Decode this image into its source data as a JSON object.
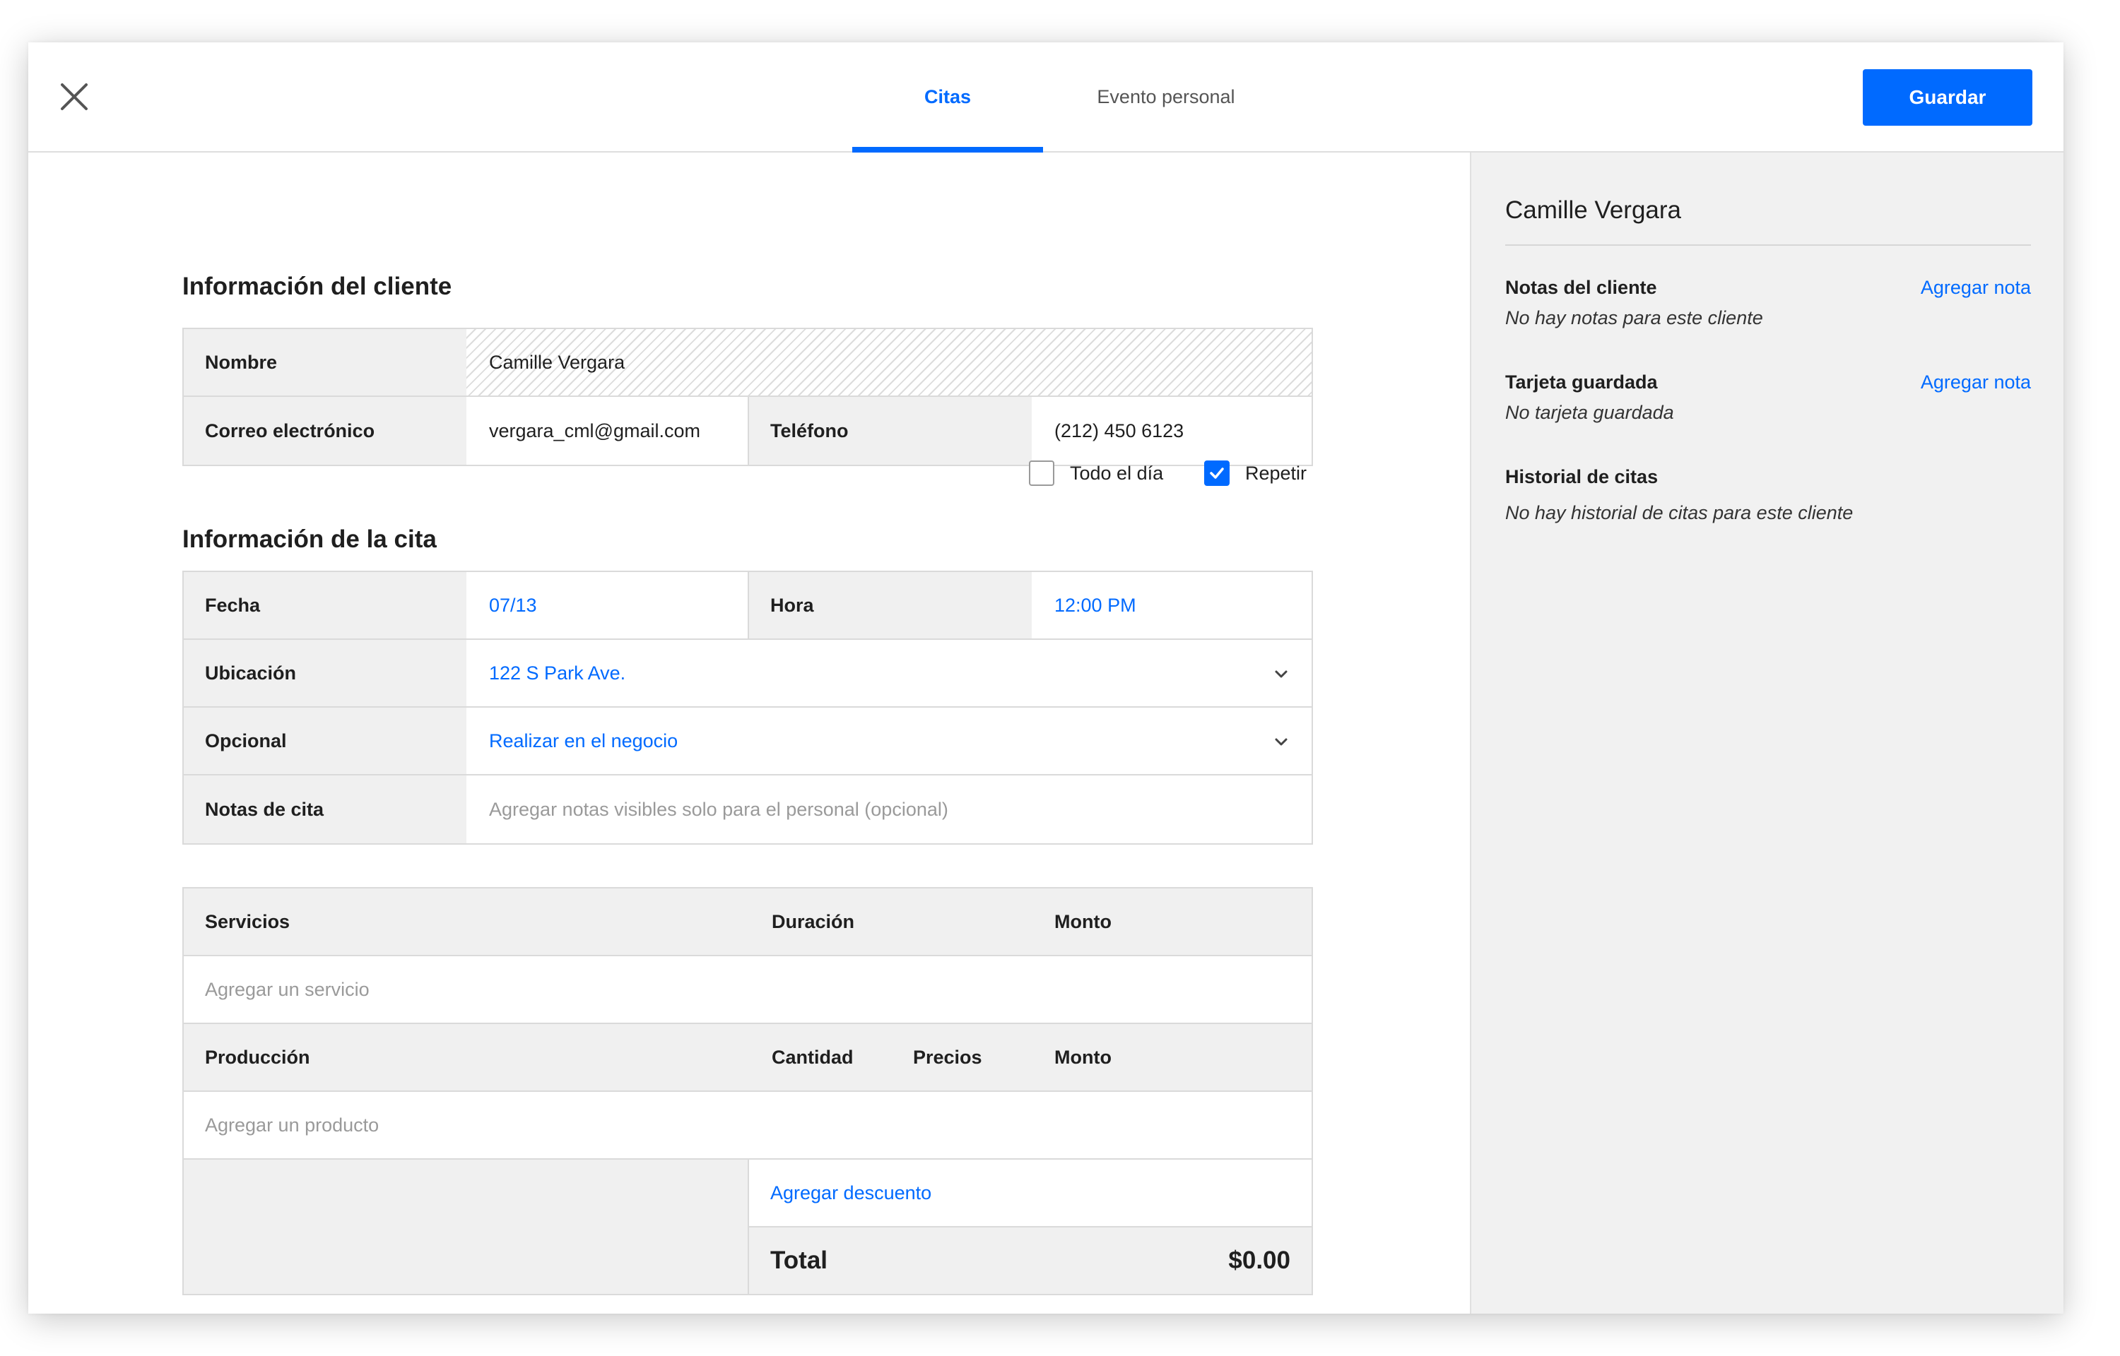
{
  "header": {
    "tabs": [
      {
        "label": "Citas",
        "active": true
      },
      {
        "label": "Evento personal",
        "active": false
      }
    ],
    "save_label": "Guardar",
    "close_icon": "close-icon"
  },
  "client_info": {
    "title": "Información del cliente",
    "name_label": "Nombre",
    "name_value": "Camille Vergara",
    "email_label": "Correo electrónico",
    "email_value": "vergara_cml@gmail.com",
    "phone_label": "Teléfono",
    "phone_value": "(212) 450 6123"
  },
  "appointment": {
    "title": "Información de la cita",
    "all_day_label": "Todo el día",
    "all_day_checked": false,
    "repeat_label": "Repetir",
    "repeat_checked": true,
    "date_label": "Fecha",
    "date_value": "07/13",
    "time_label": "Hora",
    "time_value": "12:00 PM",
    "location_label": "Ubicación",
    "location_value": "122 S Park Ave.",
    "optional_label": "Opcional",
    "optional_value": "Realizar en el negocio",
    "notes_label": "Notas de cita",
    "notes_placeholder": "Agregar notas visibles solo para el personal (opcional)"
  },
  "services": {
    "headers": [
      "Servicios",
      "Duración",
      "Monto"
    ],
    "add_placeholder": "Agregar un servicio"
  },
  "production": {
    "headers": [
      "Producción",
      "Cantidad",
      "Precios",
      "Monto"
    ],
    "add_placeholder": "Agregar un producto",
    "discount_label": "Agregar descuento",
    "total_label": "Total",
    "total_value": "$0.00"
  },
  "side_panel": {
    "client_name": "Camille Vergara",
    "notes_title": "Notas del cliente",
    "notes_link": "Agregar nota",
    "notes_empty": "No hay notas para este cliente",
    "card_title": "Tarjeta guardada",
    "card_link": "Agregar nota",
    "card_empty": "No tarjeta guardada",
    "history_title": "Historial de citas",
    "history_empty": "No hay historial de citas para este cliente"
  },
  "colors": {
    "accent": "#006aff",
    "label_bg": "#f0f0f0",
    "side_bg": "#f1f1f1"
  }
}
